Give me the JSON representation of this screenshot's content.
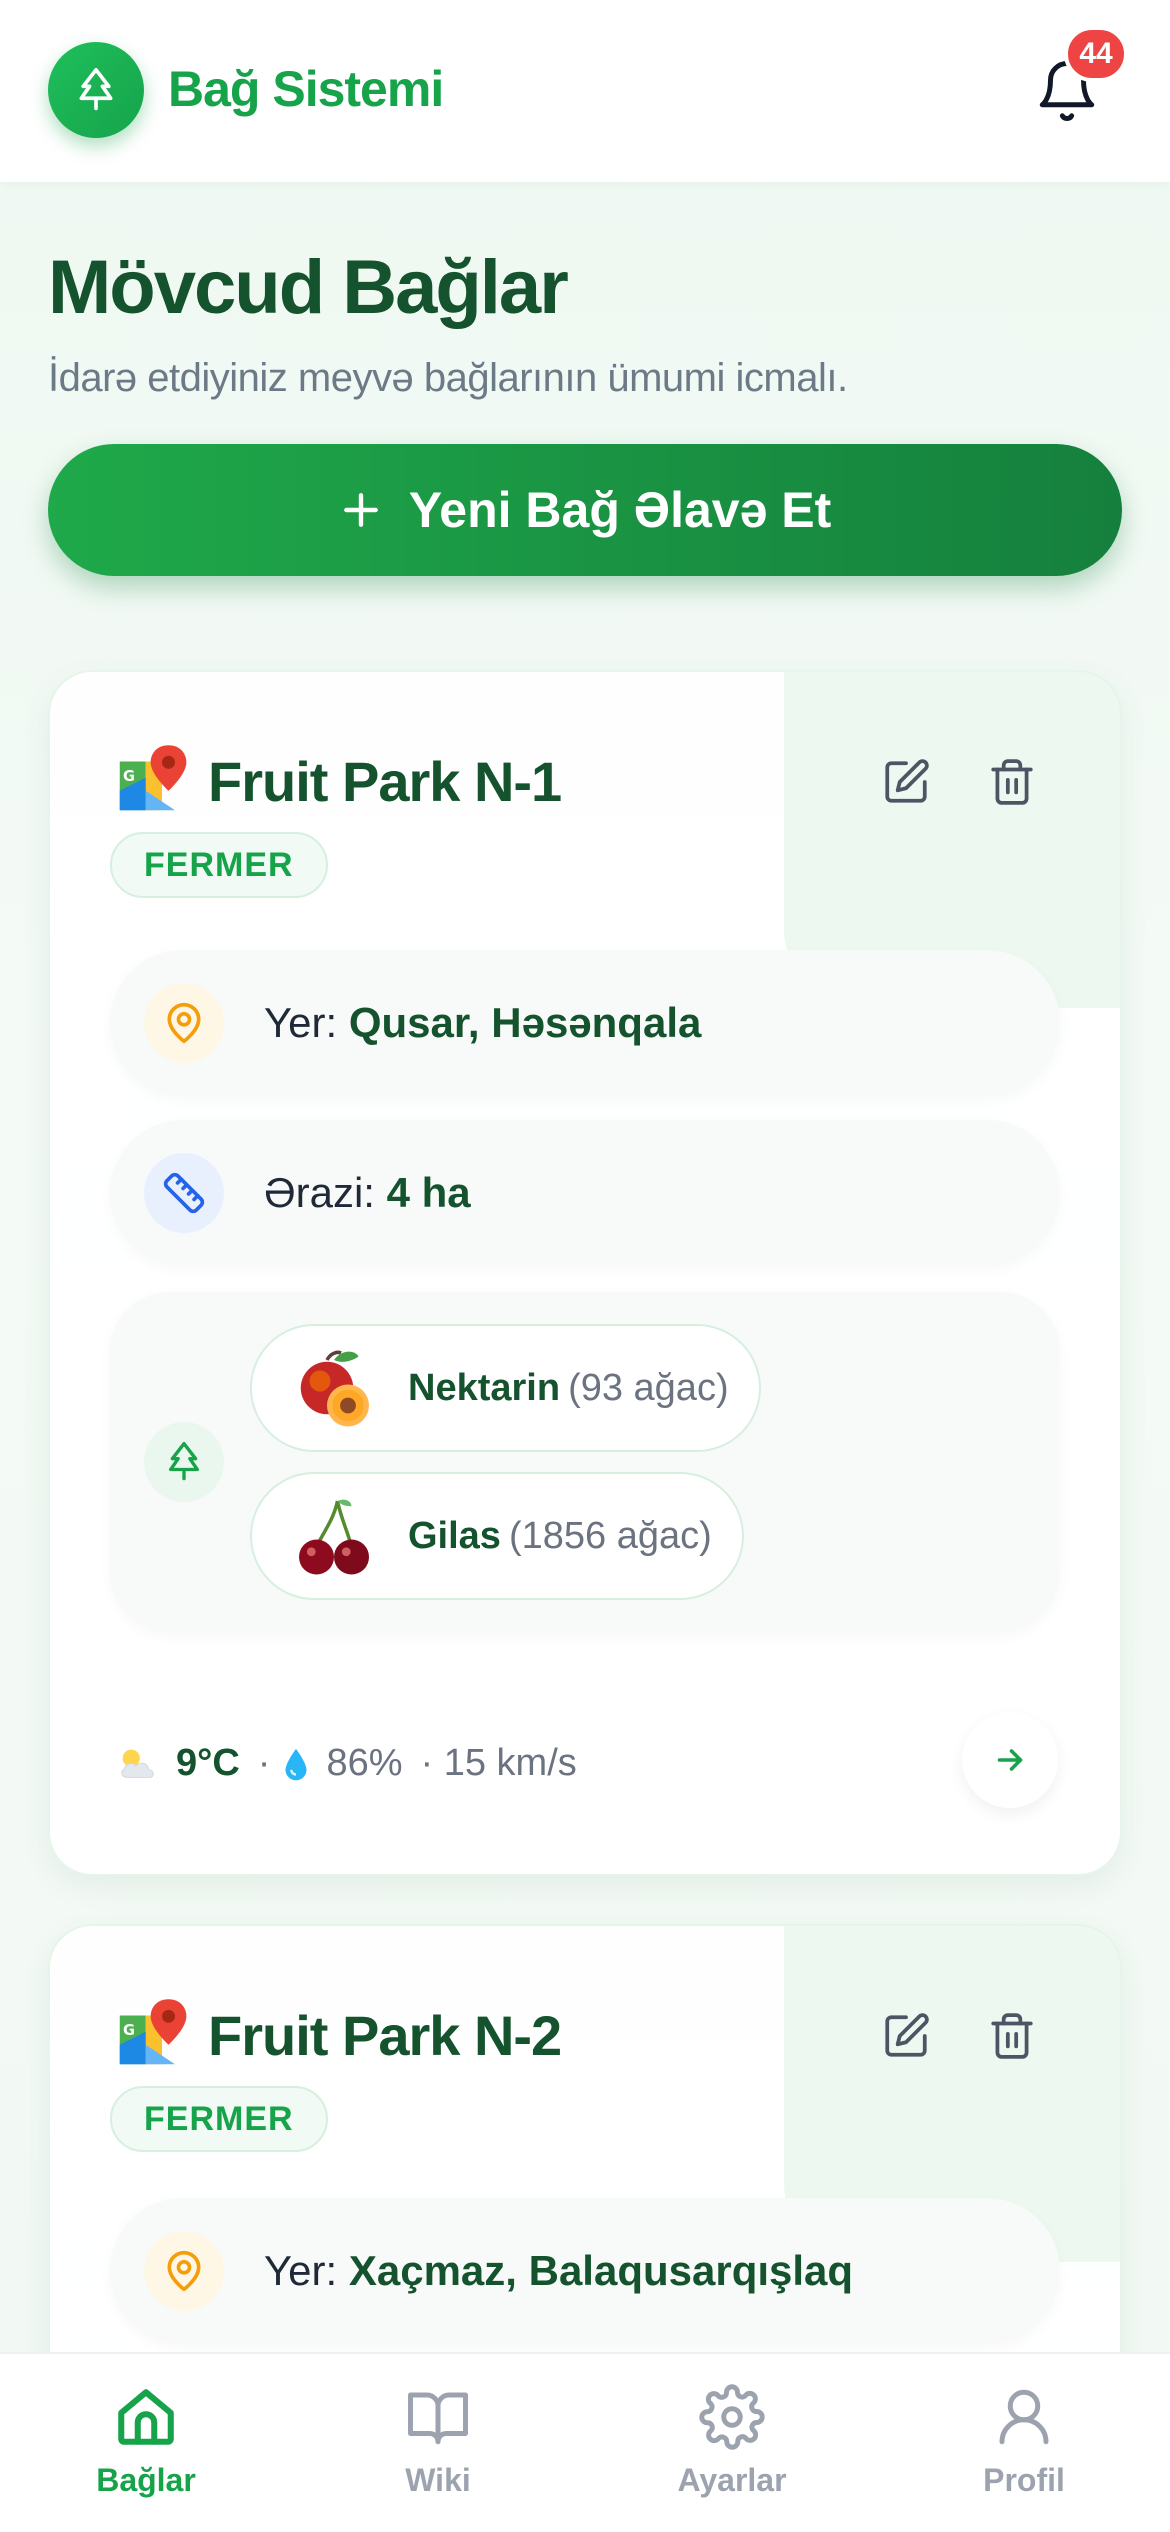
{
  "header": {
    "app_title": "Bağ Sistemi",
    "notification_count": "44",
    "logo_icon": "tree-icon",
    "bell_icon": "bell-icon"
  },
  "page": {
    "title": "Mövcud Bağlar",
    "subtitle": "İdarə etdiyiniz meyvə bağlarının ümumi icmalı.",
    "add_button_label": "Yeni Bağ Əlavə Et"
  },
  "gardens": [
    {
      "name": "Fruit Park N-1",
      "role": "FERMER",
      "location_label": "Yer:",
      "location": "Qusar, Həsənqala",
      "area_label": "Ərazi:",
      "area": "4 ha",
      "fruits": [
        {
          "name": "Nektarin",
          "count": "(93 ağac)",
          "icon": "peach-icon"
        },
        {
          "name": "Gilas",
          "count": "(1856 ağac)",
          "icon": "cherry-icon"
        }
      ],
      "weather": {
        "temp": "9°C",
        "humidity": "86%",
        "wind": "· 15 km/s",
        "sep": "·"
      }
    },
    {
      "name": "Fruit Park N-2",
      "role": "FERMER",
      "location_label": "Yer:",
      "location": "Xaçmaz, Balaqusarqışlaq"
    }
  ],
  "nav": [
    {
      "label": "Bağlar",
      "icon": "home-icon",
      "active": true
    },
    {
      "label": "Wiki",
      "icon": "book-icon",
      "active": false
    },
    {
      "label": "Ayarlar",
      "icon": "gear-icon",
      "active": false
    },
    {
      "label": "Profil",
      "icon": "user-icon",
      "active": false
    }
  ],
  "colors": {
    "brand": "#16a34a",
    "dark_green": "#14532d",
    "badge_red": "#ef4444"
  }
}
